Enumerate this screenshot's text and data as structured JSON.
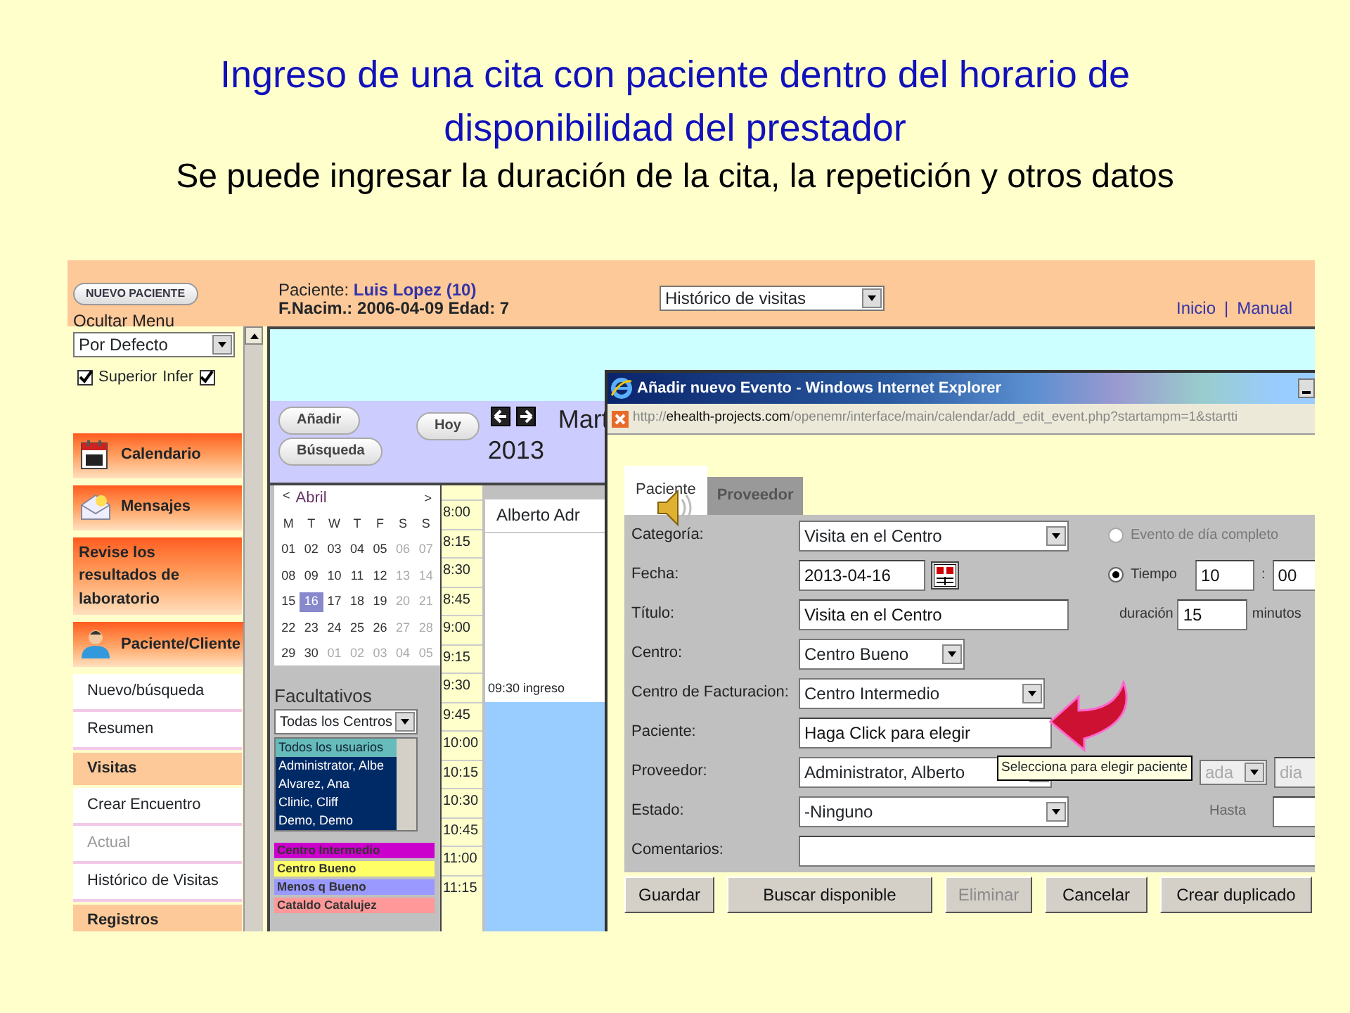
{
  "slide": {
    "title": "Ingreso de una cita con paciente dentro del horario de disponibilidad del prestador",
    "subtitle": "Se puede ingresar la duración de la cita, la repetición y otros datos"
  },
  "header": {
    "new_patient_button": "NUEVO PACIENTE",
    "hide_menu": "Ocultar Menu",
    "patient_label": "Paciente:",
    "patient_name": "Luis Lopez (10)",
    "birth_line": "F.Nacim.: 2006-04-09 Edad: 7",
    "view_select": "Histórico de visitas",
    "links": [
      "Inicio",
      "Manual"
    ],
    "link_separator": "|"
  },
  "sidebar": {
    "select": "Por Defecto",
    "checkboxes": [
      {
        "label": "Superior",
        "checked": true
      },
      {
        "label": "Infer",
        "checked": true
      }
    ],
    "items": [
      {
        "kind": "header",
        "label": "Calendario"
      },
      {
        "kind": "header",
        "label": "Mensajes"
      },
      {
        "kind": "header",
        "label": "Revise los resultados de laboratorio"
      },
      {
        "kind": "header",
        "label": "Paciente/Cliente"
      },
      {
        "kind": "link",
        "label": "Nuevo/búsqueda",
        "disabled": false
      },
      {
        "kind": "link",
        "label": "Resumen",
        "disabled": false
      },
      {
        "kind": "section",
        "label": "Visitas"
      },
      {
        "kind": "link",
        "label": "Crear Encuentro",
        "disabled": false
      },
      {
        "kind": "link",
        "label": "Actual",
        "disabled": true
      },
      {
        "kind": "link",
        "label": "Histórico de Visitas",
        "disabled": false
      },
      {
        "kind": "section",
        "label": "Registros"
      }
    ]
  },
  "toolbar": {
    "add_button": "Añadir",
    "today_button": "Hoy",
    "search_button": "Búsqueda",
    "date_line_1": "Mart",
    "date_line_2": "2013"
  },
  "mini_calendar": {
    "prev": "<",
    "month": "Abril",
    "next": ">",
    "weekdays": [
      "M",
      "T",
      "W",
      "T",
      "F",
      "S",
      "S"
    ],
    "weeks": [
      [
        {
          "day": "01",
          "muted": false,
          "selected": false
        },
        {
          "day": "02",
          "muted": false,
          "selected": false
        },
        {
          "day": "03",
          "muted": false,
          "selected": false
        },
        {
          "day": "04",
          "muted": false,
          "selected": false
        },
        {
          "day": "05",
          "muted": false,
          "selected": false
        },
        {
          "day": "06",
          "muted": true,
          "selected": false
        },
        {
          "day": "07",
          "muted": true,
          "selected": false
        }
      ],
      [
        {
          "day": "08",
          "muted": false,
          "selected": false
        },
        {
          "day": "09",
          "muted": false,
          "selected": false
        },
        {
          "day": "10",
          "muted": false,
          "selected": false
        },
        {
          "day": "11",
          "muted": false,
          "selected": false
        },
        {
          "day": "12",
          "muted": false,
          "selected": false
        },
        {
          "day": "13",
          "muted": true,
          "selected": false
        },
        {
          "day": "14",
          "muted": true,
          "selected": false
        }
      ],
      [
        {
          "day": "15",
          "muted": false,
          "selected": false
        },
        {
          "day": "16",
          "muted": false,
          "selected": true
        },
        {
          "day": "17",
          "muted": false,
          "selected": false
        },
        {
          "day": "18",
          "muted": false,
          "selected": false
        },
        {
          "day": "19",
          "muted": false,
          "selected": false
        },
        {
          "day": "20",
          "muted": true,
          "selected": false
        },
        {
          "day": "21",
          "muted": true,
          "selected": false
        }
      ],
      [
        {
          "day": "22",
          "muted": false,
          "selected": false
        },
        {
          "day": "23",
          "muted": false,
          "selected": false
        },
        {
          "day": "24",
          "muted": false,
          "selected": false
        },
        {
          "day": "25",
          "muted": false,
          "selected": false
        },
        {
          "day": "26",
          "muted": false,
          "selected": false
        },
        {
          "day": "27",
          "muted": true,
          "selected": false
        },
        {
          "day": "28",
          "muted": true,
          "selected": false
        }
      ],
      [
        {
          "day": "29",
          "muted": false,
          "selected": false
        },
        {
          "day": "30",
          "muted": false,
          "selected": false
        },
        {
          "day": "01",
          "muted": true,
          "selected": false
        },
        {
          "day": "02",
          "muted": true,
          "selected": false
        },
        {
          "day": "03",
          "muted": true,
          "selected": false
        },
        {
          "day": "04",
          "muted": true,
          "selected": false
        },
        {
          "day": "05",
          "muted": true,
          "selected": false
        }
      ]
    ]
  },
  "providers_panel": {
    "title": "Facultativos",
    "facility_select": "Todas los Centros",
    "users": [
      {
        "name": "Todos los usuarios",
        "selected": false
      },
      {
        "name": "Administrator, Albe",
        "selected": true
      },
      {
        "name": "Alvarez, Ana",
        "selected": true
      },
      {
        "name": "Clinic, Cliff",
        "selected": true
      },
      {
        "name": "Demo, Demo",
        "selected": true
      }
    ]
  },
  "legend": [
    {
      "label": "Centro Intermedio",
      "color": "#cc00cc"
    },
    {
      "label": "Centro Bueno",
      "color": "#ffff66"
    },
    {
      "label": "Menos q Bueno",
      "color": "#9999ff"
    },
    {
      "label": "Cataldo Catalujez",
      "color": "#ff9999"
    }
  ],
  "day_view": {
    "column_header": "Alberto Adr",
    "times": [
      "8:00",
      "8:15",
      "8:30",
      "8:45",
      "9:00",
      "9:15",
      "9:30",
      "9:45",
      "10:00",
      "10:15",
      "10:30",
      "10:45",
      "11:00",
      "11:15"
    ],
    "event_label": "09:30 ingreso"
  },
  "popup": {
    "title": "Añadir nuevo Evento - Windows Internet Explorer",
    "url_scheme": "http://",
    "url_host": "ehealth-projects.com",
    "url_path": "/openemr/interface/main/calendar/add_edit_event.php?startampm=1&startti",
    "tabs": [
      {
        "label": "Paciente",
        "selected": true
      },
      {
        "label": "Proveedor",
        "selected": false
      }
    ],
    "fields": [
      {
        "label": "Categoría:",
        "kind": "select",
        "value": "Visita en el Centro"
      },
      {
        "label": "Fecha:",
        "kind": "date",
        "value": "2013-04-16"
      },
      {
        "label": "Título:",
        "kind": "text",
        "value": "Visita en el Centro"
      },
      {
        "label": "Centro:",
        "kind": "select",
        "value": "Centro Bueno"
      },
      {
        "label": "Centro de Facturacion:",
        "kind": "select",
        "value": "Centro Intermedio"
      },
      {
        "label": "Paciente:",
        "kind": "text",
        "value": "Haga Click para elegir"
      },
      {
        "label": "Proveedor:",
        "kind": "select",
        "value": "Administrator, Alberto"
      },
      {
        "label": "Estado:",
        "kind": "select",
        "value": "-Ninguno"
      },
      {
        "label": "Comentarios:",
        "kind": "text"
      }
    ],
    "all_day": {
      "label": "Evento de día completo",
      "selected": false,
      "disabled": true
    },
    "time": {
      "label": "Tiempo",
      "selected": true,
      "hour": "10",
      "separator": ":",
      "minute": "00"
    },
    "duration": {
      "label": "duración",
      "value": "15",
      "unit": "minutos"
    },
    "repeat": {
      "select": "ada",
      "input": "dia"
    },
    "until": {
      "label": "Hasta"
    },
    "buttons": [
      {
        "label": "Guardar",
        "disabled": false
      },
      {
        "label": "Buscar disponible",
        "disabled": false
      },
      {
        "label": "Eliminar",
        "disabled": true
      },
      {
        "label": "Cancelar",
        "disabled": false
      },
      {
        "label": "Crear duplicado",
        "disabled": false
      }
    ],
    "tooltip": "Selecciona para elegir paciente"
  }
}
